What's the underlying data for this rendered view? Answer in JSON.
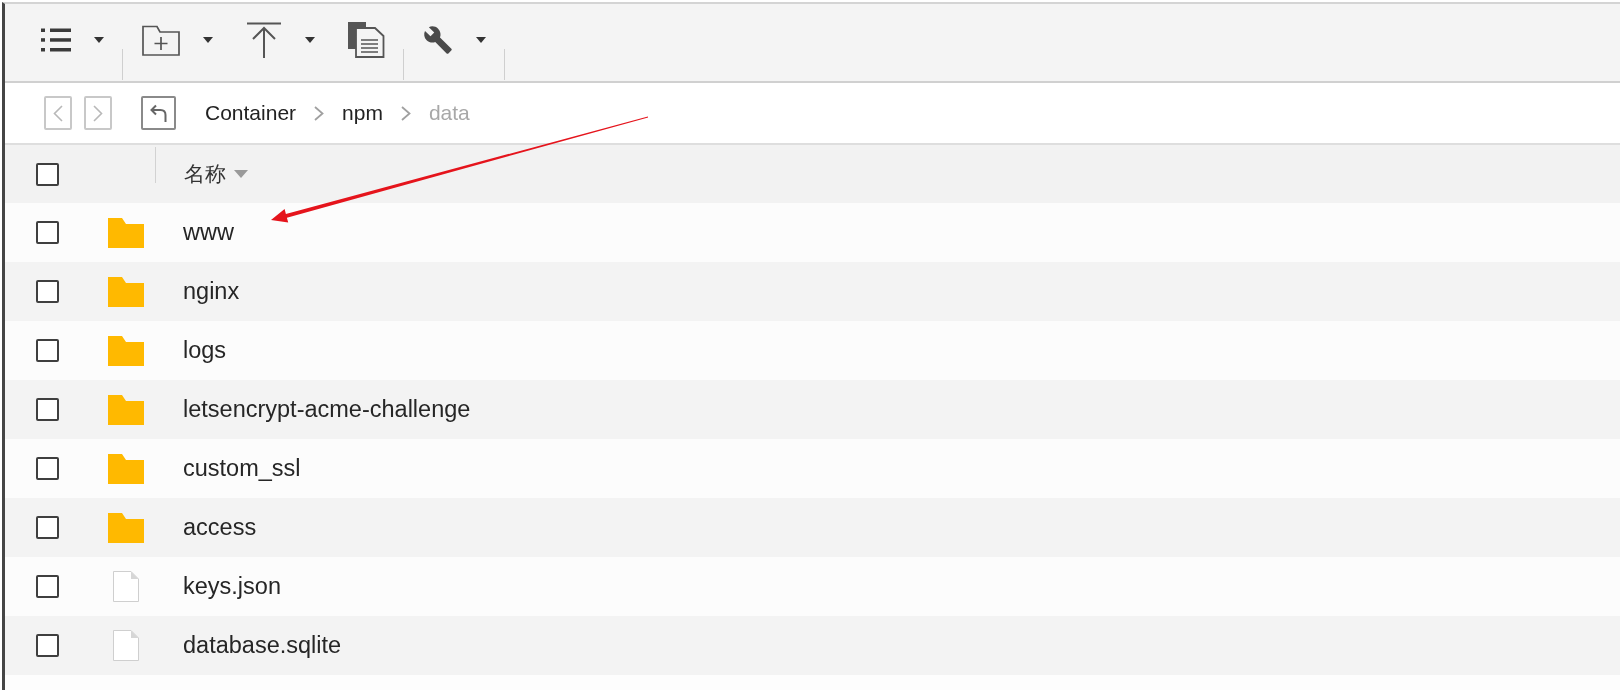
{
  "toolbar": {
    "groups": [
      {
        "buttons": [
          {
            "kind": "list-view",
            "menu": true
          }
        ]
      },
      {
        "buttons": [
          {
            "kind": "new-folder",
            "menu": true
          },
          {
            "kind": "upload",
            "menu": true
          },
          {
            "kind": "copy",
            "menu": false
          }
        ]
      },
      {
        "buttons": [
          {
            "kind": "tools",
            "menu": true
          }
        ]
      }
    ]
  },
  "navigation": {
    "buttons": [
      {
        "kind": "back",
        "disabled": true
      },
      {
        "kind": "forward",
        "disabled": true
      },
      {
        "kind": "parent",
        "disabled": false
      }
    ],
    "breadcrumb": [
      {
        "label": "Container",
        "current": false
      },
      {
        "label": "npm",
        "current": false
      },
      {
        "label": "data",
        "current": true
      }
    ]
  },
  "table": {
    "select_all": {
      "checked": false
    },
    "columns": [
      {
        "label": "名称",
        "sorted": true
      }
    ],
    "rows": [
      {
        "name": "www",
        "kind": "folder",
        "checked": false
      },
      {
        "name": "nginx",
        "kind": "folder",
        "checked": false
      },
      {
        "name": "logs",
        "kind": "folder",
        "checked": false
      },
      {
        "name": "letsencrypt-acme-challenge",
        "kind": "folder",
        "checked": false
      },
      {
        "name": "custom_ssl",
        "kind": "folder",
        "checked": false
      },
      {
        "name": "access",
        "kind": "folder",
        "checked": false
      },
      {
        "name": "keys.json",
        "kind": "file",
        "checked": false
      },
      {
        "name": "database.sqlite",
        "kind": "file",
        "checked": false
      }
    ]
  }
}
